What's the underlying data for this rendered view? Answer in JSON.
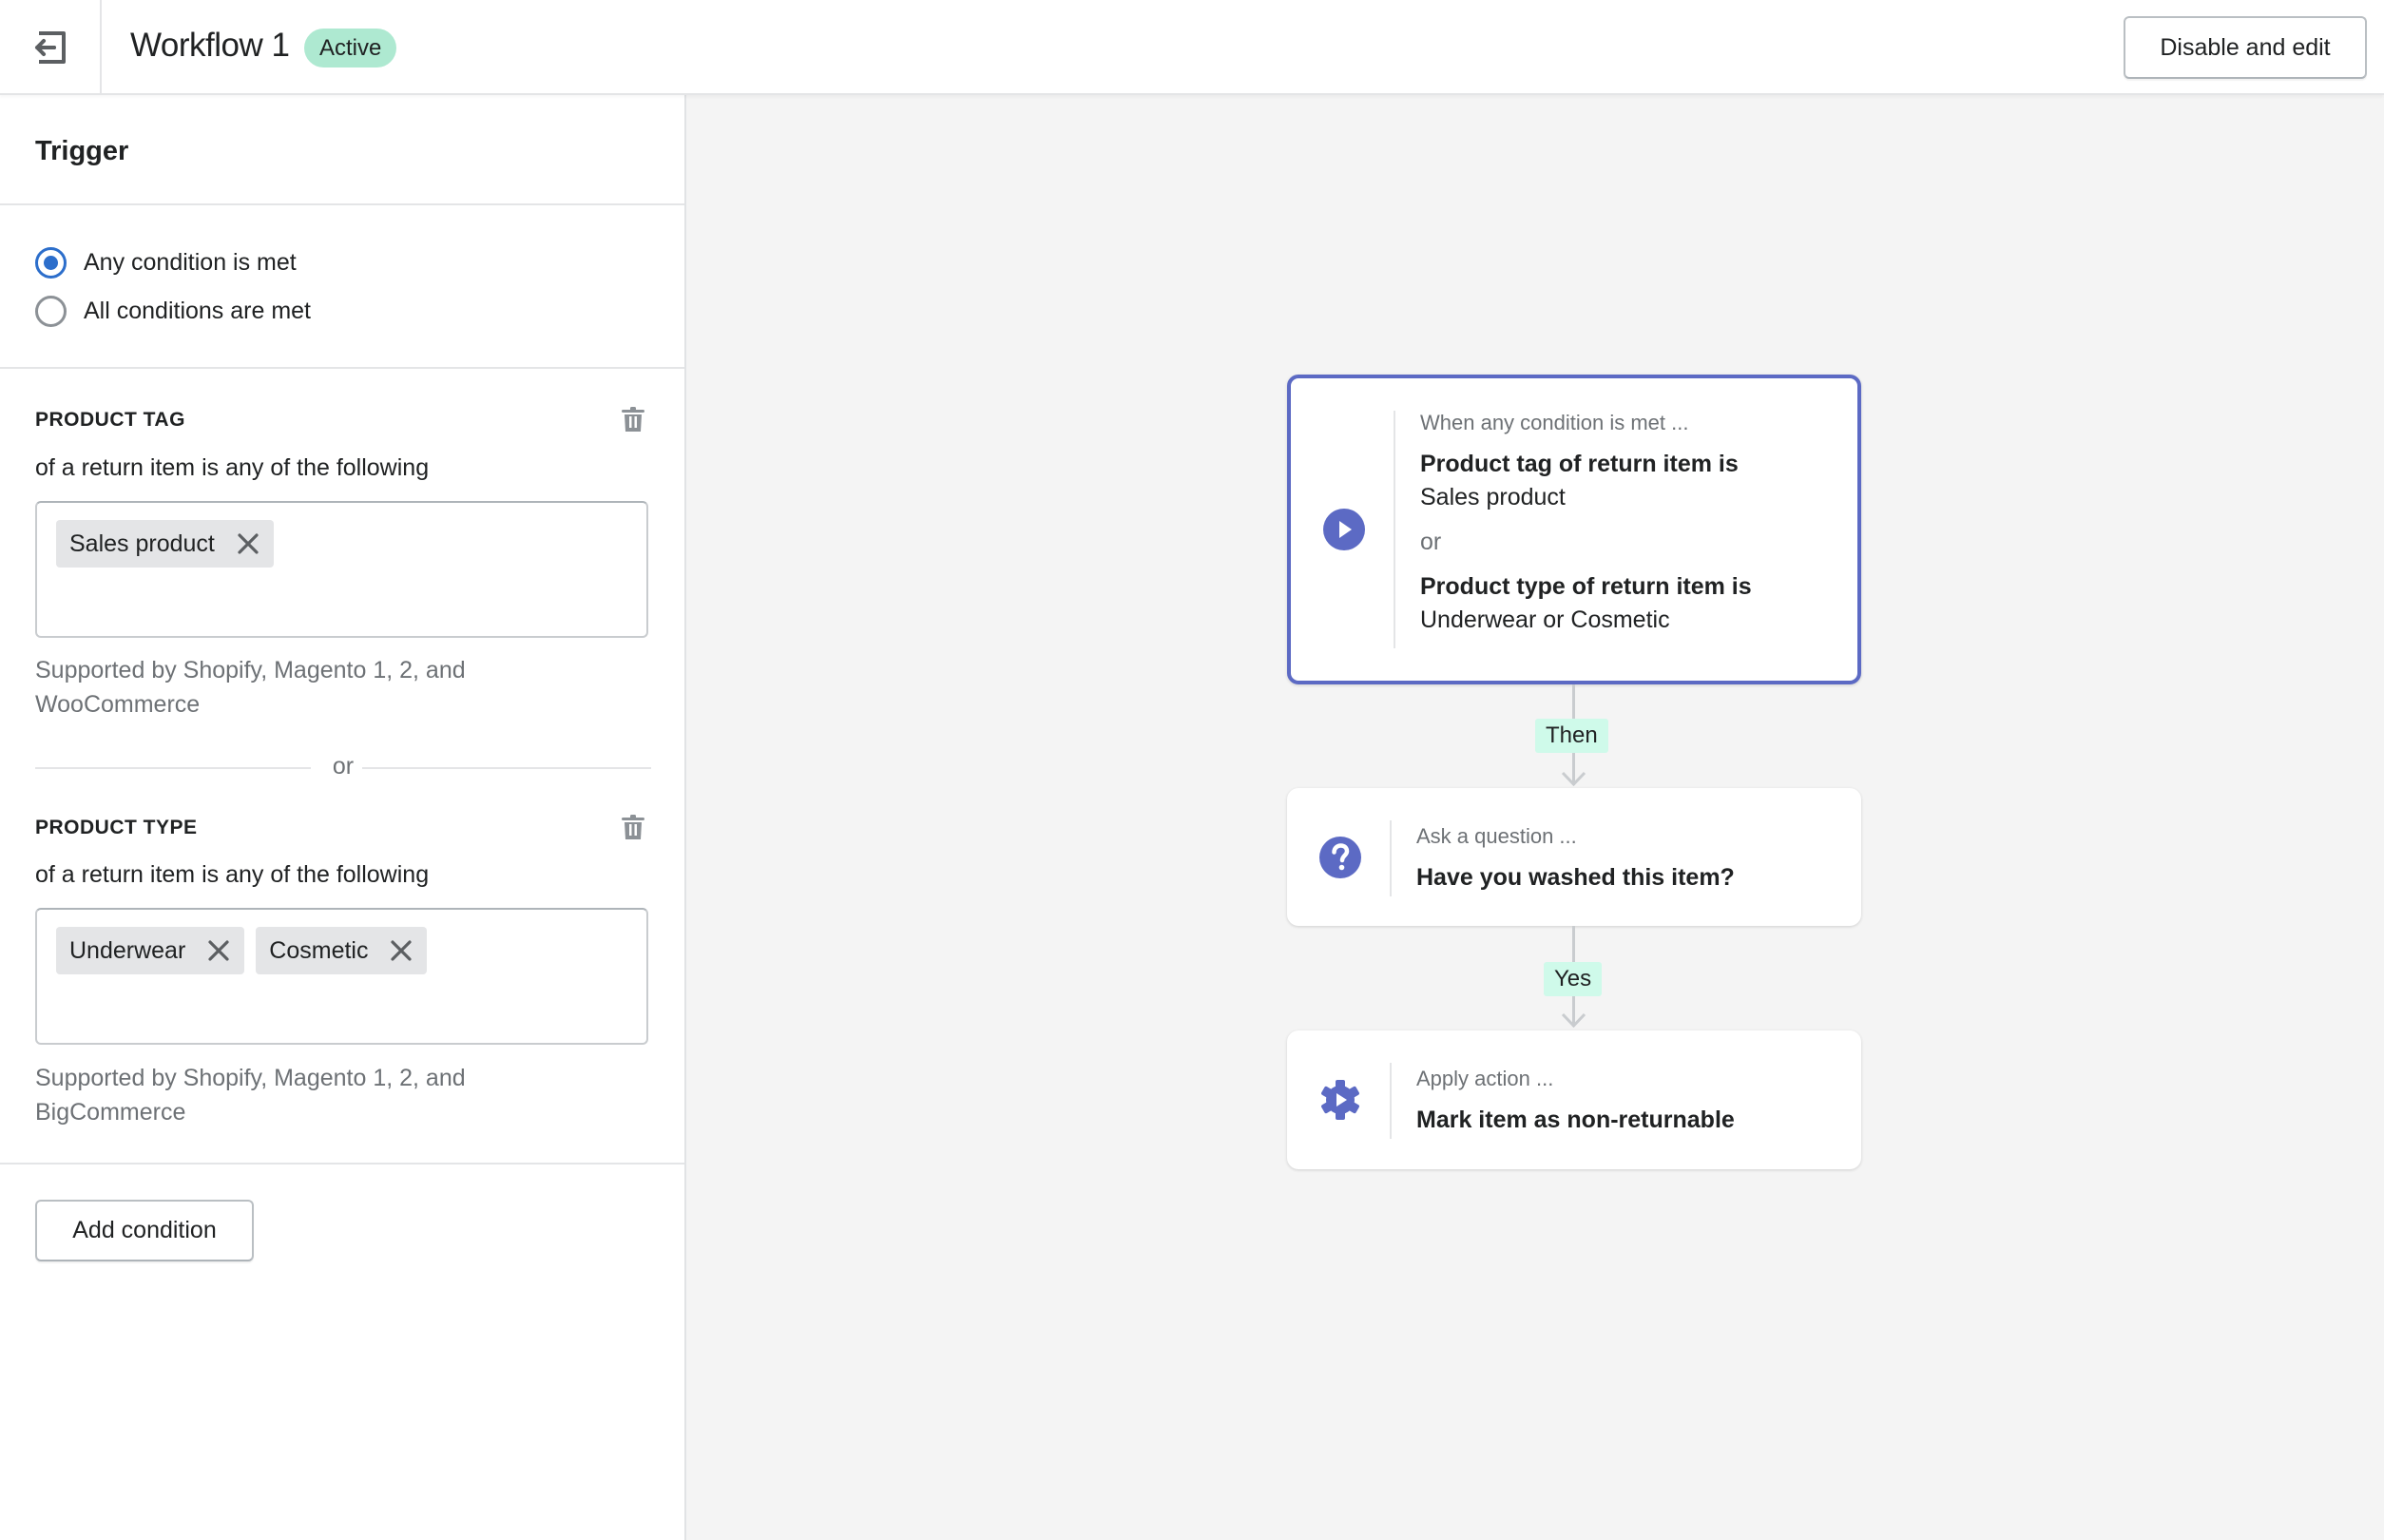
{
  "header": {
    "back_icon": "exit-arrow-left-icon",
    "title": "Workflow 1",
    "status_badge": "Active",
    "disable_button": "Disable and edit"
  },
  "sidebar": {
    "section_title": "Trigger",
    "match_options": [
      {
        "label": "Any condition is met",
        "selected": true
      },
      {
        "label": "All conditions are met",
        "selected": false
      }
    ],
    "conditions": [
      {
        "label": "PRODUCT TAG",
        "subtitle": "of a return item is any of the following",
        "tags": [
          "Sales product"
        ],
        "helper": "Supported by Shopify, Magento 1, 2, and WooCommerce"
      },
      {
        "label": "PRODUCT TYPE",
        "subtitle": "of a return item is any of the following",
        "tags": [
          "Underwear",
          "Cosmetic"
        ],
        "helper": "Supported by Shopify, Magento 1, 2, and BigCommerce"
      }
    ],
    "or_divider": "or",
    "add_condition_button": "Add condition"
  },
  "flow": {
    "trigger_card": {
      "icon": "play-circle-icon",
      "kicker": "When any condition is met ...",
      "conditions": [
        {
          "title": "Product tag of return item is",
          "value": "Sales product"
        },
        {
          "title": "Product type of return item is",
          "value": "Underwear or Cosmetic"
        }
      ],
      "separator": "or"
    },
    "edge_1_label": "Then",
    "question_card": {
      "icon": "question-circle-icon",
      "kicker": "Ask a question ...",
      "main": "Have you washed this item?"
    },
    "edge_2_label": "Yes",
    "action_card": {
      "icon": "gear-play-icon",
      "kicker": "Apply action ...",
      "main": "Mark item as non-returnable"
    }
  },
  "colors": {
    "accent": "#5c6ac4",
    "radio_selected": "#2c6ecb",
    "badge_bg": "#aee9d1",
    "edge_label_bg": "#cffaea"
  }
}
